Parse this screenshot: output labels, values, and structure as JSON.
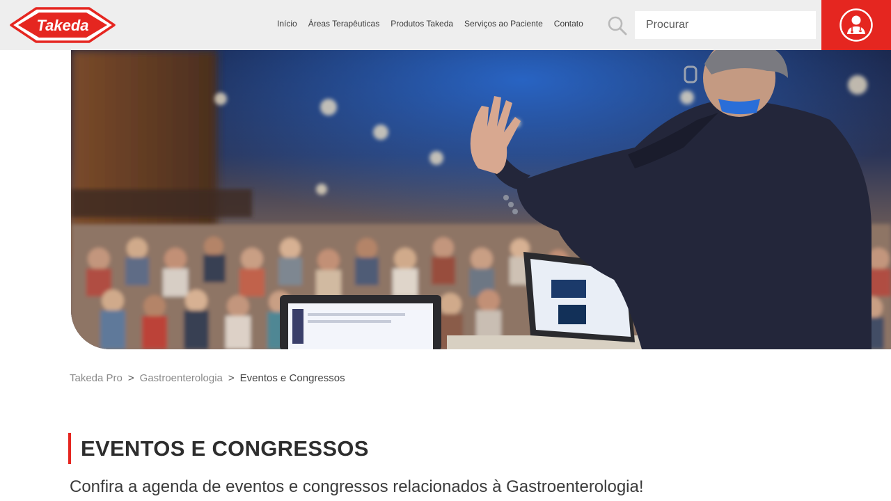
{
  "brand": {
    "logo_text": "Takeda",
    "accent_color": "#e52620"
  },
  "nav": {
    "items": [
      {
        "label": "Início"
      },
      {
        "label": "Áreas Terapêuticas"
      },
      {
        "label": "Produtos Takeda"
      },
      {
        "label": "Serviços ao Paciente"
      },
      {
        "label": "Contato"
      }
    ]
  },
  "search": {
    "placeholder": "Procurar",
    "icon": "search-icon"
  },
  "profile": {
    "icon": "doctor-user-icon"
  },
  "hero": {
    "image": "speaker-at-conference-photo"
  },
  "breadcrumb": {
    "items": [
      {
        "label": "Takeda Pro"
      },
      {
        "label": "Gastroenterologia"
      }
    ],
    "separator": ">",
    "current": "Eventos e Congressos"
  },
  "page": {
    "title": "EVENTOS E CONGRESSOS",
    "subtitle": "Confira a agenda de eventos e congressos relacionados à Gastroenterologia!"
  }
}
